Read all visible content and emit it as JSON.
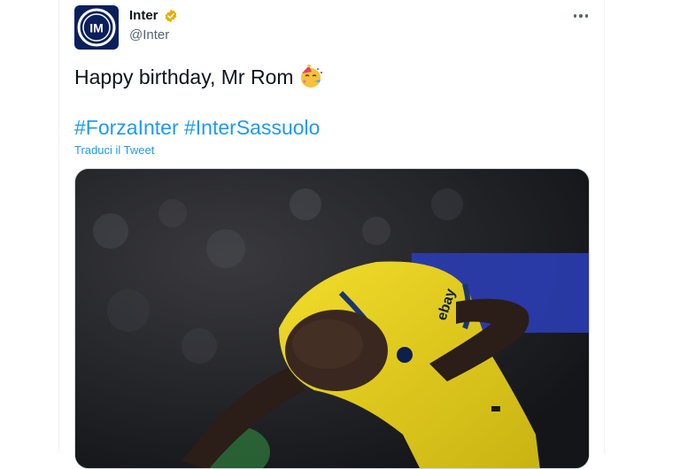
{
  "author": {
    "name": "Inter",
    "handle": "@Inter",
    "verified": true,
    "avatar_icon": "inter-logo-icon",
    "verified_icon": "verified-badge-icon",
    "verified_color": "#e8b000"
  },
  "menu": {
    "icon": "more-options-icon"
  },
  "tweet": {
    "text": "Happy birthday, Mr Rom",
    "emoji_icon": "party-face-emoji-icon",
    "hashtags": [
      "#ForzaInter",
      "#InterSassuolo"
    ],
    "translate_label": "Traduci il Tweet"
  },
  "media": {
    "kit_sponsor": "ebay",
    "image_description_icon": "player-photo"
  },
  "colors": {
    "link": "#1d9bf0",
    "text": "#0f1419",
    "secondary": "#536471",
    "avatar_bg": "#0a1f5c",
    "kit_yellow": "#e8d21c"
  }
}
